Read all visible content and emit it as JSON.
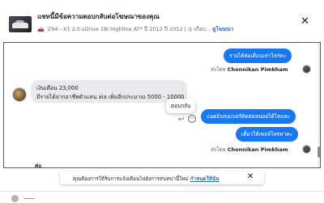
{
  "header": {
    "title": "แชทนี้มีข้อความตอบกลับต่อโฆษณาของคุณ",
    "car_model": "Z94 - X1 2.0 sDrive 18i Highline AT*",
    "year_label_1": "ปี 2012",
    "year_label_2": "ปี 2012",
    "extra_text": "| ◎ เกือบ...",
    "view_ad_link": "ดูโฆษณา",
    "close_icon": "close-icon"
  },
  "messages": {
    "out_top": "รายได้ต่อเดือนเท่าไหร่คะ",
    "sent_by_label": "ส่งโดย",
    "sender_name": "Chonnikan Pimkham",
    "incoming_line1": "เงินเดือน 23,000",
    "incoming_line2": "มีรายได้จากอาชีพตัวแทน aia เพิ่มอีกประมาณ 5000 - 10000",
    "tooltip": "ตอบกลับ",
    "out_1": "แอดมินขอเบอร์ติดต่อหน่อยได้ไหมคะ",
    "out_2": "เดี๋ยวให้เซลล์โทรหาคะ",
    "partial_text": "ค่ะ"
  },
  "notice": {
    "text": "คุณต้องการให้รับการแจ้งเตือนไปยังการสนทนานี้ใหม่",
    "link": "กำหนดให้ฉัน"
  },
  "colors": {
    "accent": "#1877f2",
    "incoming_bg": "#e9eaee",
    "link": "#216fdb"
  }
}
